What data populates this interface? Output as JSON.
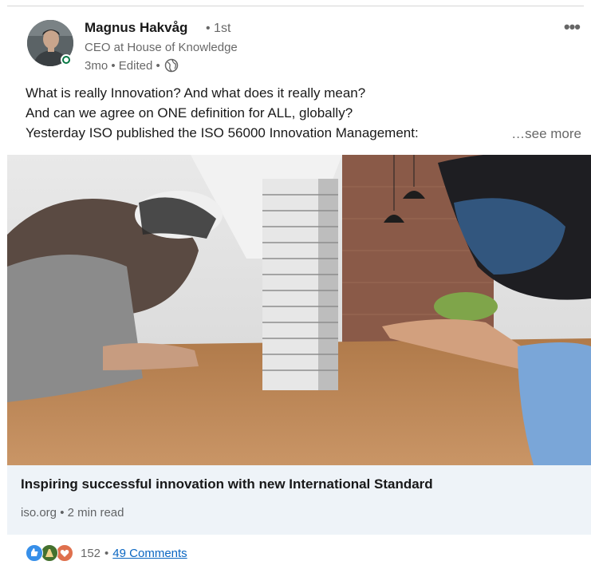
{
  "author": {
    "name": "Magnus Hakvåg",
    "degree": "• 1st",
    "headline": "CEO at House of Knowledge",
    "meta": "3mo • Edited •",
    "visibility_icon": "globe-icon",
    "presence_color": "#057642"
  },
  "menu": {
    "overflow_label": "•••"
  },
  "post": {
    "lines": [
      "What is really Innovation? And what does it really mean?",
      "And can we agree on ONE definition for ALL, globally?",
      "Yesterday ISO published the ISO 56000 Innovation Management:"
    ],
    "see_more": "…see more"
  },
  "article": {
    "title": "Inspiring successful innovation with new International Standard",
    "source": "iso.org • 2 min read",
    "image_description_icon": "article-image"
  },
  "social": {
    "reactions": [
      "like-icon",
      "celebrate-icon",
      "love-icon"
    ],
    "reaction_count": "152",
    "separator": "•",
    "comments": "49 Comments"
  },
  "colors": {
    "link": "#0a66c2",
    "article_bg": "#eef3f8",
    "like": "#378fe9",
    "celebrate": "#44712e",
    "love": "#df704d"
  }
}
